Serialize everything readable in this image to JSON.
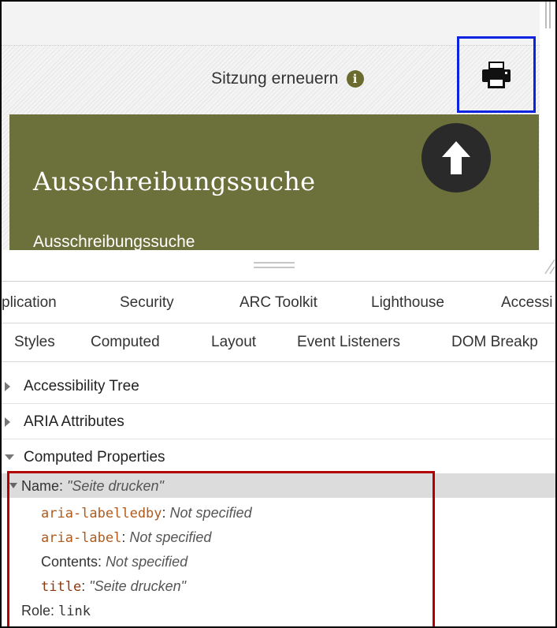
{
  "page": {
    "session_label": "Sitzung erneuern",
    "banner_title": "Ausschreibungssuche",
    "banner_subtitle": "Ausschreibungssuche",
    "colors": {
      "banner": "#6c703a",
      "focus_outline": "#0b22e0",
      "highlight_box": "#b30000"
    }
  },
  "icons": {
    "info": "info-circle-icon",
    "print": "print-icon",
    "back_to_top": "arrow-up-circle-icon"
  },
  "devtools": {
    "main_tabs": [
      "plication",
      "Security",
      "ARC Toolkit",
      "Lighthouse",
      "Accessi"
    ],
    "sub_tabs": [
      "Styles",
      "Computed",
      "Layout",
      "Event Listeners",
      "DOM Breakp"
    ],
    "sections": {
      "accessibility_tree": "Accessibility Tree",
      "aria_attributes": "ARIA Attributes",
      "computed_properties": "Computed Properties"
    },
    "computed": {
      "name_label": "Name:",
      "name_value": "\"Seite drucken\"",
      "aria_labelledby_key": "aria-labelledby",
      "aria_labelledby_value": "Not specified",
      "aria_label_key": "aria-label",
      "aria_label_value": "Not specified",
      "contents_key": "Contents:",
      "contents_value": "Not specified",
      "title_key": "title",
      "title_value": "\"Seite drucken\"",
      "role_key": "Role:",
      "role_value": "link"
    }
  }
}
